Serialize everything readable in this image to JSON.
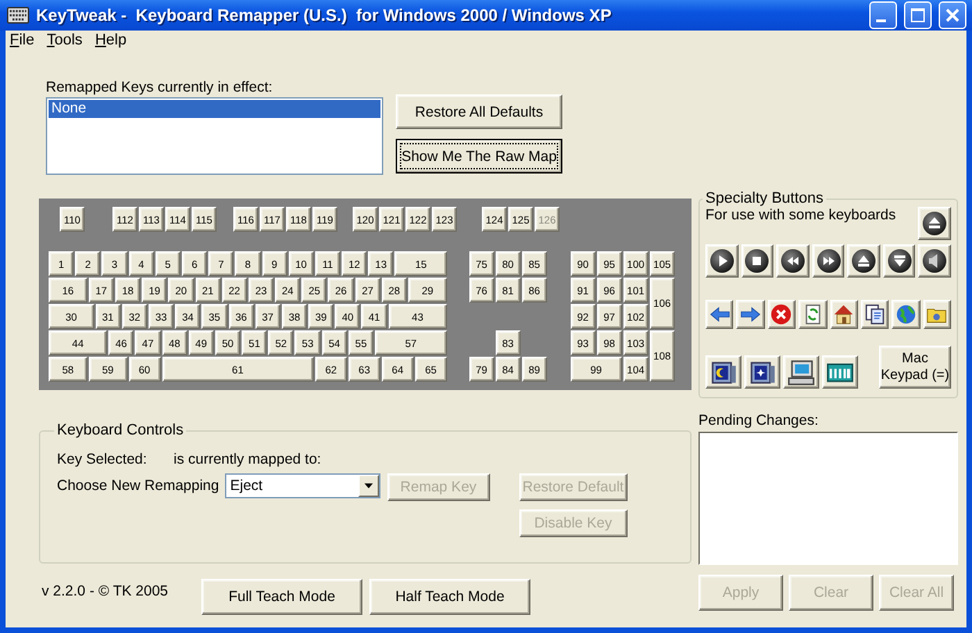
{
  "window": {
    "title": "KeyTweak -  Keyboard Remapper (U.S.)  for Windows 2000 / Windows XP"
  },
  "menu": [
    {
      "label": "File"
    },
    {
      "label": "Tools"
    },
    {
      "label": "Help"
    }
  ],
  "remapped_list": {
    "label": "Remapped Keys currently in effect:",
    "items": [
      {
        "text": "None",
        "selected": true
      }
    ]
  },
  "top_buttons": [
    {
      "label": "Restore All Defaults",
      "focused": false
    },
    {
      "label": "Show Me The Raw Map",
      "focused": true
    }
  ],
  "keyboard": {
    "function_groups": [
      [
        {
          "label": "110",
          "disabled": false
        }
      ],
      [
        {
          "label": "112",
          "disabled": false
        },
        {
          "label": "113",
          "disabled": false
        },
        {
          "label": "114",
          "disabled": false
        },
        {
          "label": "115",
          "disabled": false
        }
      ],
      [
        {
          "label": "116",
          "disabled": false
        },
        {
          "label": "117",
          "disabled": false
        },
        {
          "label": "118",
          "disabled": false
        },
        {
          "label": "119",
          "disabled": false
        }
      ],
      [
        {
          "label": "120",
          "disabled": false
        },
        {
          "label": "121",
          "disabled": false
        },
        {
          "label": "122",
          "disabled": false
        },
        {
          "label": "123",
          "disabled": false
        }
      ],
      [
        {
          "label": "124",
          "disabled": false
        },
        {
          "label": "125",
          "disabled": false
        },
        {
          "label": "126",
          "disabled": true
        }
      ]
    ],
    "main_rows": [
      [
        "1",
        "2",
        "3",
        "4",
        "5",
        "6",
        "7",
        "8",
        "9",
        "10",
        "11",
        "12",
        "13",
        "15"
      ],
      [
        "16",
        "17",
        "18",
        "19",
        "20",
        "21",
        "22",
        "23",
        "24",
        "25",
        "26",
        "27",
        "28",
        "29"
      ],
      [
        "30",
        "31",
        "32",
        "33",
        "34",
        "35",
        "36",
        "37",
        "38",
        "39",
        "40",
        "41",
        "43"
      ],
      [
        "44",
        "46",
        "47",
        "48",
        "49",
        "50",
        "51",
        "52",
        "53",
        "54",
        "55",
        "57"
      ],
      [
        "58",
        "59",
        "60",
        "61",
        "62",
        "63",
        "64",
        "65"
      ]
    ],
    "nav_keys": [
      "75",
      "80",
      "85",
      "76",
      "81",
      "86",
      "83",
      "79",
      "84",
      "89"
    ],
    "numpad_keys": [
      "90",
      "95",
      "100",
      "105",
      "91",
      "96",
      "101",
      "106",
      "92",
      "97",
      "102",
      "93",
      "98",
      "103",
      "108",
      "99",
      "104"
    ]
  },
  "specialty": {
    "title": "Specialty Buttons",
    "note": "For use with some keyboards",
    "mac_button": "Mac Keypad (=)"
  },
  "keyboard_controls": {
    "title": "Keyboard Controls",
    "key_selected_label": "Key Selected:",
    "mapped_label": "is currently mapped to:",
    "choose_label": "Choose New Remapping",
    "remap_value": "Eject",
    "buttons": [
      {
        "label": "Remap Key",
        "disabled": true
      },
      {
        "label": "Restore Default",
        "disabled": true
      },
      {
        "label": "Disable Key",
        "disabled": true
      }
    ]
  },
  "pending": {
    "label": "Pending Changes:",
    "buttons": [
      {
        "label": "Apply",
        "disabled": true
      },
      {
        "label": "Clear",
        "disabled": true
      },
      {
        "label": "Clear All",
        "disabled": true
      }
    ]
  },
  "version": "v 2.2.0 - © TK 2005",
  "teach_buttons": [
    {
      "label": "Full Teach Mode",
      "disabled": false
    },
    {
      "label": "Half Teach Mode",
      "disabled": false
    }
  ]
}
